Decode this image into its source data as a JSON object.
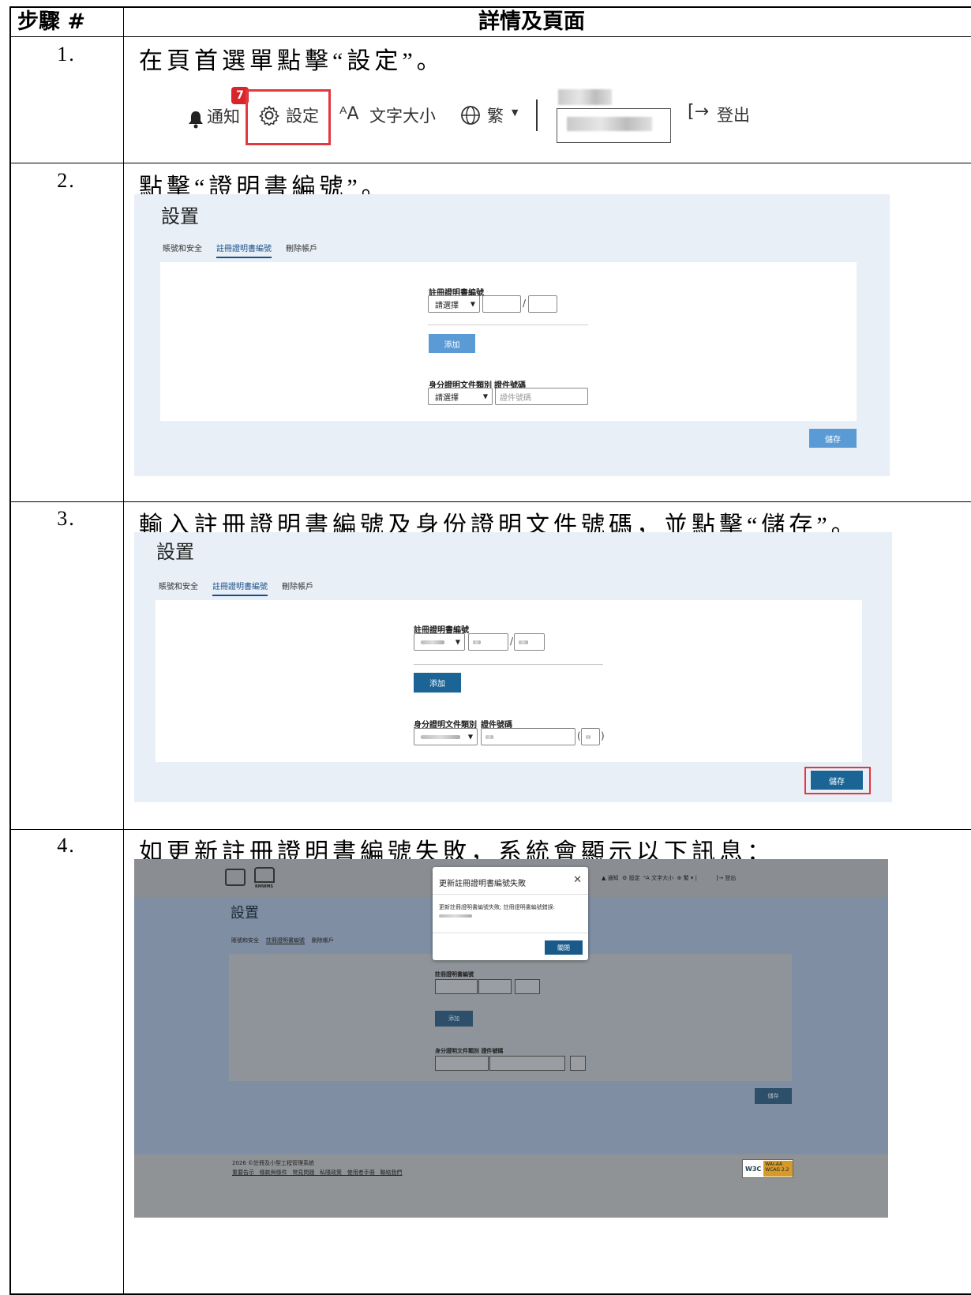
{
  "table": {
    "header_step": "步驟 #",
    "header_details": "詳情及頁面"
  },
  "steps": [
    {
      "num": "1.",
      "text": "在頁首選單點擊“設定”。"
    },
    {
      "num": "2.",
      "text": "點擊“證明書編號”。"
    },
    {
      "num": "3.",
      "text": "輸入註冊證明書編號及身份證明文件號碼，並點擊“儲存”。"
    },
    {
      "num": "4.",
      "text": "如更新註冊證明書編號失敗，系統會顯示以下訊息："
    }
  ],
  "topbar": {
    "notify": "通知",
    "badge": "7",
    "settings": "設定",
    "font_size": "文字大小",
    "language": "繁",
    "logout": "登出"
  },
  "settings_page": {
    "title": "設置",
    "tab_account": "賬號和安全",
    "tab_cert": "註冊證明書編號",
    "tab_delete": "刪除帳戶",
    "cert_label": "註冊證明書編號",
    "select_placeholder": "請選擇",
    "add_button": "添加",
    "id_type_label": "身分證明文件類別",
    "id_no_label": "證件號碼",
    "id_no_placeholder": "證件號碼",
    "save_button": "儲存"
  },
  "error_modal": {
    "title": "更新註冊證明書編號失敗",
    "message": "更新註冊證明書編號失敗; 註冊證明書編號錯誤:",
    "close_button": "關閉"
  },
  "footer": {
    "copyright": "2026 ©註冊及小型工程管理系統",
    "links": "重要告示   條款與條件   常見問題   私隱政策   使用者手冊   聯絡我們",
    "brand": "RMWMS",
    "w3c": "W3C",
    "wcag": "WAI-AA WCAG 2.2"
  }
}
